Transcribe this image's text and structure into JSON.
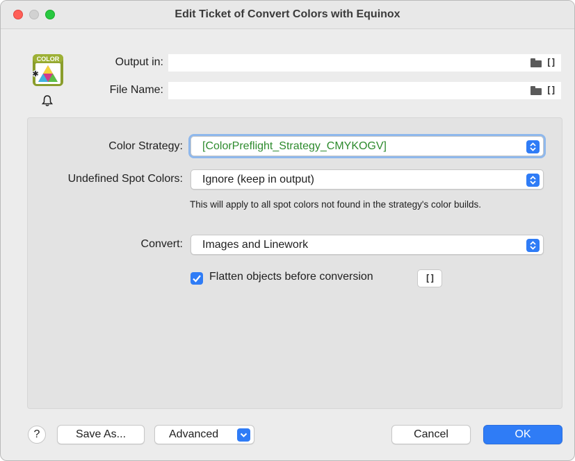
{
  "window": {
    "title": "Edit Ticket of Convert Colors with Equinox"
  },
  "app_icon": {
    "badge_text": "COLOR"
  },
  "fields": {
    "output_in": {
      "label": "Output in:",
      "value": ""
    },
    "file_name": {
      "label": "File Name:",
      "value": ""
    }
  },
  "variable_symbol": "[]",
  "settings": {
    "color_strategy": {
      "label": "Color Strategy:",
      "value": "[ColorPreflight_Strategy_CMYKOGV]",
      "value_color": "#2e8b2e"
    },
    "undefined_spot_colors": {
      "label": "Undefined Spot Colors:",
      "value": "Ignore (keep in output)",
      "help": "This will apply to all spot colors not found in the strategy's color builds."
    },
    "convert": {
      "label": "Convert:",
      "value": "Images and Linework"
    },
    "flatten": {
      "label": "Flatten objects before conversion",
      "checked": true
    }
  },
  "footer": {
    "help": "?",
    "save_as": "Save As...",
    "advanced": "Advanced",
    "cancel": "Cancel",
    "ok": "OK"
  },
  "colors": {
    "accent": "#2f7cf6",
    "close": "#ff5f57",
    "zoom": "#28c840"
  }
}
